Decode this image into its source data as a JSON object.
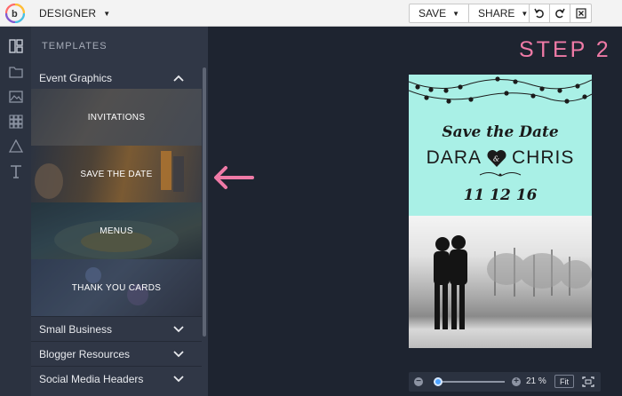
{
  "app": {
    "menu_label": "DESIGNER"
  },
  "toolbar": {
    "save_label": "SAVE",
    "share_label": "SHARE"
  },
  "panel": {
    "title": "TEMPLATES",
    "open_category": "Event Graphics",
    "templates": [
      {
        "label": "INVITATIONS"
      },
      {
        "label": "SAVE THE DATE"
      },
      {
        "label": "MENUS"
      },
      {
        "label": "THANK YOU CARDS"
      }
    ],
    "categories": [
      {
        "label": "Small Business"
      },
      {
        "label": "Blogger Resources"
      },
      {
        "label": "Social Media Headers"
      }
    ]
  },
  "canvas": {
    "step_label": "STEP 2",
    "card": {
      "title": "Save the Date",
      "name1": "DARA",
      "name2": "CHRIS",
      "ampersand": "&",
      "date": "11 12 16"
    }
  },
  "zoom": {
    "level": "21 %",
    "fit_label": "Fit",
    "minus": "−",
    "plus": "+",
    "level_fraction": 0.06
  },
  "colors": {
    "accent_pink": "#ef7aa6",
    "card_mint": "#a9f0e6",
    "panel_bg": "#303746",
    "rail_bg": "#2b3240",
    "canvas_bg": "#1e2430"
  },
  "icons": [
    "befunky-logo-icon",
    "layouts-icon",
    "folder-icon",
    "image-icon",
    "grid-icon",
    "triangle-icon",
    "text-icon",
    "undo-icon",
    "redo-icon",
    "close-icon",
    "chevron-up-icon",
    "chevron-down-icon",
    "arrow-left-icon",
    "fullscreen-icon"
  ]
}
